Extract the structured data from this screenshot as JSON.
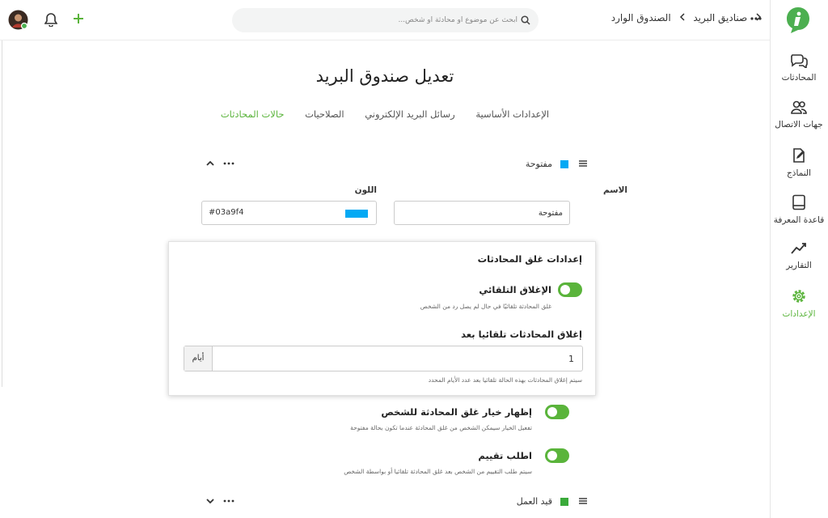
{
  "sidebar": {
    "items": [
      {
        "label": "المحادثات",
        "icon": "conversations-icon"
      },
      {
        "label": "جهات الاتصال",
        "icon": "contacts-icon"
      },
      {
        "label": "النماذج",
        "icon": "templates-icon"
      },
      {
        "label": "قاعدة المعرفة",
        "icon": "knowledge-base-icon"
      },
      {
        "label": "التقارير",
        "icon": "reports-icon"
      },
      {
        "label": "الإعدادات",
        "icon": "settings-icon",
        "active": true
      }
    ]
  },
  "header": {
    "breadcrumb": [
      "صناديق البريد",
      "الصندوق الوارد"
    ],
    "search_placeholder": "ابحث عن موضوع أو محادثة أو شخص..."
  },
  "page": {
    "title": "تعديل صندوق البريد",
    "tabs": [
      "الإعدادات الأساسية",
      "رسائل البريد الإلكتروني",
      "الصلاحيات",
      "حالات المحادثات"
    ],
    "active_tab": "حالات المحادثات"
  },
  "status_open": {
    "name": "مفتوحة",
    "color": "#03a9f4",
    "name_label": "الاسم",
    "color_label": "اللون",
    "name_value": "مفتوحة",
    "color_value": "#03a9f4"
  },
  "close_settings": {
    "title": "إعدادات غلق المحادثات",
    "auto_close_label": "الإغلاق التلقائي",
    "auto_close_help": "غلق المحادثة تلقائيًا في حال لم يصل رد من الشخص",
    "after_label": "إغلاق المحادثات تلقائيا بعد",
    "days_value": "1",
    "days_unit": "أيام",
    "days_help": "سيتم إغلاق المحادثات بهذه الحالة تلقائيا بعد عدد الأيام المحدد"
  },
  "options": {
    "show_close_label": "إظهار خيار غلق المحادثة للشخص",
    "show_close_help": "تفعيل الخيار سيمكن الشخص من غلق المحادثة عندما تكون بحالة مفتوحة",
    "rating_label": "اطلب تقييم",
    "rating_help": "سيتم طلب التقييم من الشخص بعد غلق المحادثة تلقائيا أو بواسطة الشخص"
  },
  "status_in_progress": {
    "name": "قيد العمل",
    "color": "#3aaa3a"
  },
  "colors": {
    "accent": "#5ab43b",
    "brand": "#4caf50"
  }
}
